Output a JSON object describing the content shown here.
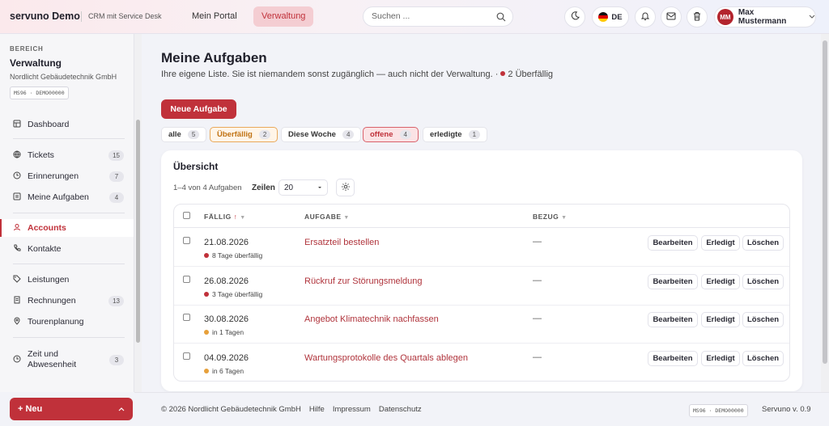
{
  "app": {
    "brand": "servuno Demo",
    "brand_sub": "CRM mit Service Desk"
  },
  "topnav": [
    {
      "label": "Mein Portal"
    },
    {
      "label": "Verwaltung",
      "active": true
    }
  ],
  "search": {
    "placeholder": "Suchen ...",
    "value": ""
  },
  "header_actions": {
    "theme_icon": "moon-icon",
    "lang": "DE",
    "bell_icon": "bell-icon",
    "mail_icon": "mail-icon",
    "trash_icon": "trash-icon"
  },
  "user": {
    "initials": "MM",
    "name": "Max Mustermann"
  },
  "sidebar": {
    "eyebrow": "BEREICH",
    "title": "Verwaltung",
    "org": "Nordlicht Gebäudetechnik GmbH",
    "code": "MS96 · DEMO00000",
    "items": [
      {
        "label": "Dashboard",
        "icon": "dashboard-icon"
      },
      {
        "label": "Tickets",
        "badge": "15",
        "icon": "globe-icon"
      },
      {
        "label": "Erinnerungen",
        "badge": "7",
        "icon": "clock-icon"
      },
      {
        "label": "Meine Aufgaben",
        "badge": "4",
        "icon": "list-icon"
      },
      {
        "label": "Accounts",
        "active": true,
        "icon": "user-icon"
      },
      {
        "label": "Kontakte",
        "icon": "phone-icon"
      },
      {
        "label": "Leistungen",
        "icon": "tag-icon"
      },
      {
        "label": "Rechnungen",
        "badge": "13",
        "icon": "invoice-icon"
      },
      {
        "label": "Tourenplanung",
        "icon": "pin-icon"
      },
      {
        "label": "Zeit und",
        "label2": "Abwesenheit",
        "badge": "3",
        "icon": "clock-icon"
      }
    ],
    "new_button": "+ Neu"
  },
  "page": {
    "title": "Meine Aufgaben",
    "description": "Ihre eigene Liste. Sie ist niemandem sonst zugänglich — auch nicht der Verwaltung. ·",
    "overdue_note": "2 Überfällig",
    "new_task_button": "Neue Aufgabe"
  },
  "filters": [
    {
      "label": "alle",
      "count": "5"
    },
    {
      "label": "Überfällig",
      "count": "2",
      "style": "warn"
    },
    {
      "label": "Diese Woche",
      "count": "4"
    },
    {
      "label": "offene",
      "count": "4",
      "style": "sel"
    },
    {
      "label": "erledigte",
      "count": "1"
    }
  ],
  "overview": {
    "title": "Übersicht",
    "range": "1–4 von 4 Aufgaben",
    "rows_label": "Zeilen",
    "rows_value": "20"
  },
  "table": {
    "columns": {
      "due": "FÄLLIG",
      "task": "AUFGABE",
      "ref": "BEZUG"
    },
    "rows": [
      {
        "date": "21.08.2026",
        "status": "8 Tage überfällig",
        "status_color": "#c0313a",
        "task": "Ersatzteil bestellen",
        "ref": "—"
      },
      {
        "date": "26.08.2026",
        "status": "3 Tage überfällig",
        "status_color": "#c0313a",
        "task": "Rückruf zur Störungsmeldung",
        "ref": "—"
      },
      {
        "date": "30.08.2026",
        "status": "in 1 Tagen",
        "status_color": "#e7a03a",
        "task": "Angebot Klimatechnik nachfassen",
        "ref": "—"
      },
      {
        "date": "04.09.2026",
        "status": "in 6 Tagen",
        "status_color": "#e7a03a",
        "task": "Wartungsprotokolle des Quartals ablegen",
        "ref": "—"
      }
    ],
    "actions": {
      "edit": "Bearbeiten",
      "done": "Erledigt",
      "delete": "Löschen"
    }
  },
  "footer": {
    "copyright": "© 2026 Nordlicht Gebäudetechnik GmbH",
    "links": [
      "Hilfe",
      "Impressum",
      "Datenschutz"
    ],
    "code": "MS96 · DEMO00000",
    "version": "Servuno v. 0.9"
  }
}
